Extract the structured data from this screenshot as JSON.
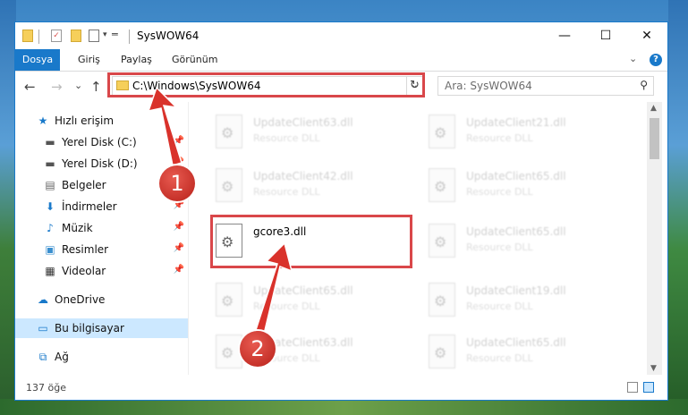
{
  "window": {
    "title": "SysWOW64",
    "controls": {
      "minimize": "—",
      "maximize": "☐",
      "close": "✕"
    }
  },
  "ribbon": {
    "tabs": [
      "Dosya",
      "Giriş",
      "Paylaş",
      "Görünüm"
    ],
    "help": "?"
  },
  "navigation": {
    "back": "←",
    "forward": "→",
    "recent": "⌄",
    "up": "↑",
    "address": "C:\\Windows\\SysWOW64",
    "refresh": "↻",
    "search_placeholder": "Ara: SysWOW64"
  },
  "sidebar": {
    "items": [
      {
        "label": "Hızlı erişim",
        "icon": "star-icon"
      },
      {
        "label": "Yerel Disk (C:)",
        "icon": "drive-icon"
      },
      {
        "label": "Yerel Disk (D:)",
        "icon": "drive-icon"
      },
      {
        "label": "Belgeler",
        "icon": "documents-icon"
      },
      {
        "label": "İndirmeler",
        "icon": "download-icon"
      },
      {
        "label": "Müzik",
        "icon": "music-icon"
      },
      {
        "label": "Resimler",
        "icon": "pictures-icon"
      },
      {
        "label": "Videolar",
        "icon": "video-icon"
      },
      {
        "label": "OneDrive",
        "icon": "cloud-icon"
      },
      {
        "label": "Bu bilgisayar",
        "icon": "computer-icon"
      },
      {
        "label": "Ağ",
        "icon": "network-icon"
      }
    ]
  },
  "files": {
    "left": [
      {
        "name": "UpdateClient63.dll",
        "type": "Resource DLL"
      },
      {
        "name": "UpdateClient42.dll",
        "type": "Resource DLL"
      },
      {
        "name": "gcore3.dll",
        "type": ""
      },
      {
        "name": "UpdateClient65.dll",
        "type": "Resource DLL"
      },
      {
        "name": "UpdateClient63.dll",
        "type": "Resource DLL"
      }
    ],
    "right": [
      {
        "name": "UpdateClient21.dll",
        "type": "Resource DLL"
      },
      {
        "name": "UpdateClient65.dll",
        "type": "Resource DLL"
      },
      {
        "name": "UpdateClient65.dll",
        "type": "Resource DLL"
      },
      {
        "name": "UpdateClient19.dll",
        "type": "Resource DLL"
      },
      {
        "name": "UpdateClient65.dll",
        "type": "Resource DLL"
      }
    ]
  },
  "status": {
    "item_count": "137 öğe"
  },
  "callouts": {
    "step1": "1",
    "step2": "2"
  },
  "colors": {
    "accent": "#1979ca",
    "highlight": "#d9474a",
    "selected": "#cce8ff"
  }
}
